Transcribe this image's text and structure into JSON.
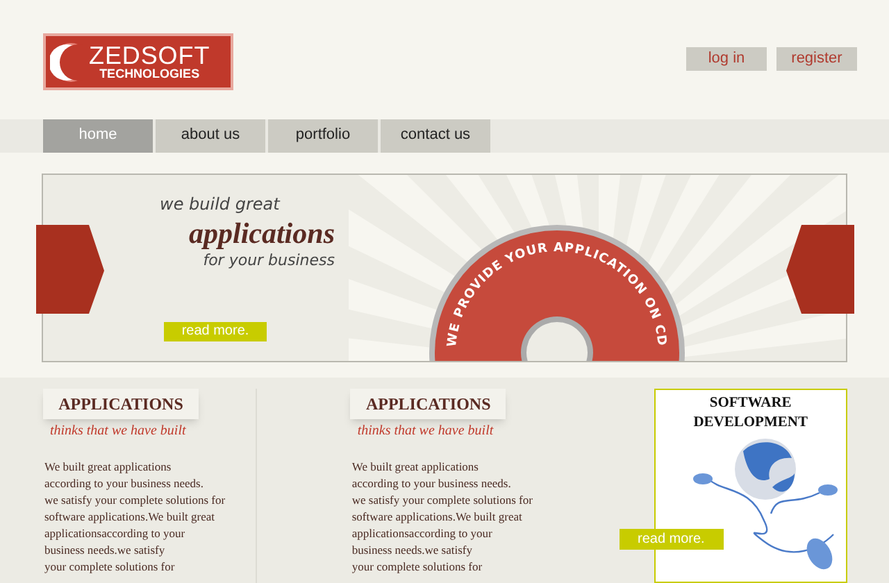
{
  "logo": {
    "line_1": "ZEDSOFT",
    "line_2": "TECHNOLOGIES"
  },
  "account_links": [
    "log in",
    "register"
  ],
  "nav": [
    {
      "label": "home",
      "selected": true
    },
    {
      "label": "about us",
      "selected": false
    },
    {
      "label": "portfolio",
      "selected": false
    },
    {
      "label": "contact us",
      "selected": false
    }
  ],
  "banner": {
    "line_1": "we build great",
    "headline": "applications",
    "line_3": "for your business",
    "button": "read more.",
    "cd_text": "WE PROVIDE YOUR APPLICATION ON CD"
  },
  "columns": [
    {
      "title": "APPLICATIONS",
      "subtitle": "thinks that we have built",
      "lines": [
        "We built great applications",
        "according to your business needs.",
        "we satisfy your complete solutions for",
        "software applications.We built great",
        "applicationsaccording to your",
        "business needs.we satisfy",
        "your complete solutions for"
      ]
    },
    {
      "title": "APPLICATIONS",
      "subtitle": "thinks that we have built",
      "lines": [
        "We built great applications",
        "according to your business needs.",
        "we satisfy your complete solutions for",
        "software applications.We built great",
        "applicationsaccording to your",
        "business needs.we satisfy",
        "your complete solutions for"
      ]
    }
  ],
  "promo": {
    "title": "SOFTWARE DEVELOPMENT",
    "button": "read more."
  }
}
